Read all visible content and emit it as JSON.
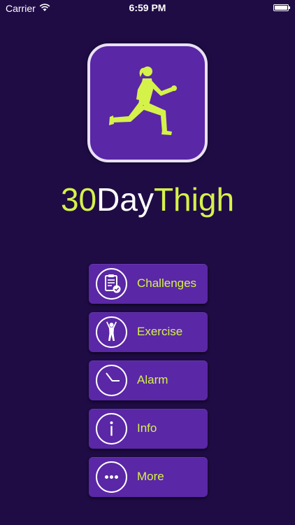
{
  "status_bar": {
    "carrier": "Carrier",
    "time": "6:59 PM",
    "wifi_icon": "wifi-icon",
    "battery_icon": "battery-icon"
  },
  "app_icon": {
    "icon": "lunging-woman-icon"
  },
  "title": {
    "part1": "30",
    "part2": "Day",
    "part3": "Thigh"
  },
  "menu": [
    {
      "label": "Challenges",
      "icon": "clipboard-check-icon"
    },
    {
      "label": "Exercise",
      "icon": "person-arms-up-icon"
    },
    {
      "label": "Alarm",
      "icon": "clock-icon"
    },
    {
      "label": "Info",
      "icon": "info-icon"
    },
    {
      "label": "More",
      "icon": "ellipsis-icon"
    }
  ],
  "colors": {
    "background": "#1f0c45",
    "button": "#5a27a6",
    "accent": "#d5f24a",
    "white": "#ffffff"
  }
}
